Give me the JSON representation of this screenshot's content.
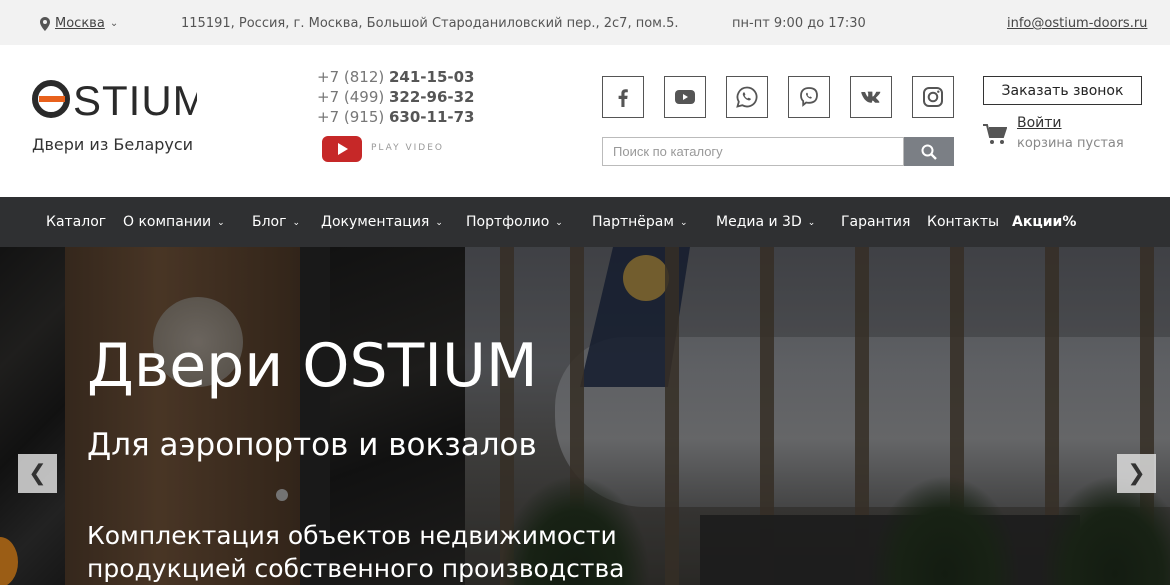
{
  "topbar": {
    "city": "Москва",
    "address": "115191, Россия, г. Москва, Большой Староданиловский пер., 2с7, пом.5.",
    "hours": "пн-пт 9:00 до 17:30",
    "email": "info@ostium-doors.ru"
  },
  "header": {
    "logo_text": "OSTIUM",
    "tagline": "Двери из Беларуси",
    "phones": [
      {
        "code": "+7 (812) ",
        "number": "241-15-03"
      },
      {
        "code": "+7 (499) ",
        "number": "322-96-32"
      },
      {
        "code": "+7 (915) ",
        "number": "630-11-73"
      }
    ],
    "play_video": "PLAY VIDEO",
    "search_placeholder": "Поиск по каталогу",
    "callback_button": "Заказать звонок",
    "login": "Войти",
    "cart_status": "корзина пустая",
    "social": [
      "facebook-icon",
      "youtube-icon",
      "whatsapp-icon",
      "viber-icon",
      "vk-icon",
      "instagram-icon"
    ]
  },
  "nav": {
    "items": [
      {
        "label": "Каталог",
        "dropdown": false
      },
      {
        "label": "О компании",
        "dropdown": true
      },
      {
        "label": "Блог",
        "dropdown": true
      },
      {
        "label": "Документация",
        "dropdown": true
      },
      {
        "label": "Портфолио",
        "dropdown": true
      },
      {
        "label": "Партнёрам",
        "dropdown": true
      },
      {
        "label": "Медиа и 3D",
        "dropdown": true
      },
      {
        "label": "Гарантия",
        "dropdown": false
      },
      {
        "label": "Контакты",
        "dropdown": false
      },
      {
        "label": "Акции%",
        "dropdown": false
      }
    ]
  },
  "hero": {
    "title": "Двери OSTIUM",
    "subtitle": "Для аэропортов и вокзалов",
    "line1": "Комплектация объектов недвижимости",
    "line2": "продукцией собственного производства"
  },
  "colors": {
    "nav_bg": "#2f3032",
    "logo_accent": "#e8611c",
    "youtube_red": "#c62828",
    "search_button": "#7b7f85"
  }
}
